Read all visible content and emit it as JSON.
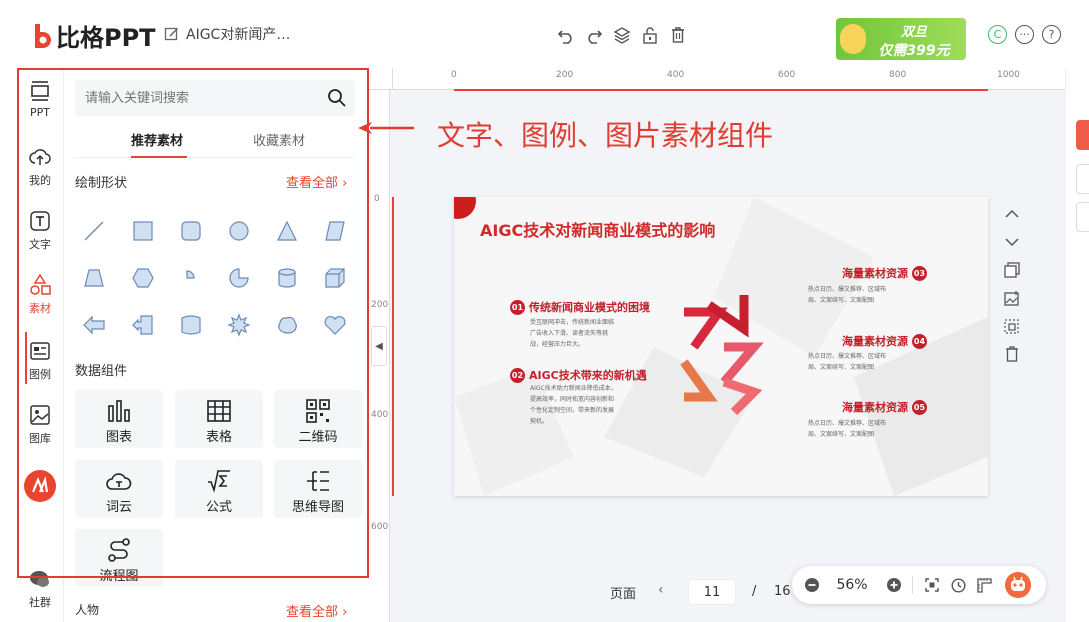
{
  "app": {
    "brand": "比格PPT",
    "doc_title": "AIGC对新闻产…"
  },
  "promo": {
    "line1": "双旦",
    "line2": "仅需399元"
  },
  "rail": {
    "items": [
      {
        "label": "PPT"
      },
      {
        "label": "我的"
      },
      {
        "label": "文字"
      },
      {
        "label": "素材"
      },
      {
        "label": "图例"
      },
      {
        "label": "图库"
      },
      {
        "label": ""
      },
      {
        "label": "社群"
      }
    ]
  },
  "panel": {
    "search_placeholder": "请输入关键词搜索",
    "tabs": [
      "推荐素材",
      "收藏素材"
    ],
    "shapes_section": {
      "title": "绘制形状",
      "see_all": "查看全部"
    },
    "data_section": {
      "title": "数据组件",
      "cards": [
        "图表",
        "表格",
        "二维码",
        "词云",
        "公式",
        "思维导图",
        "流程图"
      ]
    },
    "people_section": {
      "title": "人物",
      "see_all": "查看全部"
    }
  },
  "annotation": {
    "text": "文字、图例、图片素材组件"
  },
  "rulers": {
    "h_ticks": [
      "0",
      "200",
      "400",
      "600",
      "800",
      "1000"
    ],
    "v_ticks": [
      "0",
      "200",
      "400",
      "600"
    ]
  },
  "slide": {
    "title": "AIGC技术对新闻商业模式的影响",
    "points": [
      {
        "num": "01",
        "heading": "传统新闻商业模式的困境",
        "body": [
          "受互联网冲击，传统新闻业面临",
          "广告收入下滑、读者流失等挑",
          "战，经营压力巨大。"
        ]
      },
      {
        "num": "02",
        "heading": "AIGC技术带来的新机遇",
        "body": [
          "AIGC技术助力新闻业降低成本，",
          "提高效率，同时拓宽内容创新和",
          "个性化定制空间，带来新的发展",
          "契机。"
        ]
      },
      {
        "num": "03",
        "heading": "海量素材资源",
        "body": [
          "热点日历、爆文推荐、区域布",
          "局、文案续写、文案配图"
        ]
      },
      {
        "num": "04",
        "heading": "海量素材资源",
        "body": [
          "热点日历、爆文推荐、区域布",
          "局、文案续写、文案配图"
        ]
      },
      {
        "num": "05",
        "heading": "海量素材资源",
        "body": [
          "热点日历、爆文推荐、区域布",
          "局、文案续写、文案配图"
        ]
      }
    ]
  },
  "pager": {
    "label": "页面",
    "current": "11",
    "separator": "/",
    "total": "16"
  },
  "zoom": {
    "level": "56%"
  },
  "colors": {
    "accent": "#e8452c",
    "annotation": "#e03c31",
    "slide_red": "#c4202a"
  }
}
